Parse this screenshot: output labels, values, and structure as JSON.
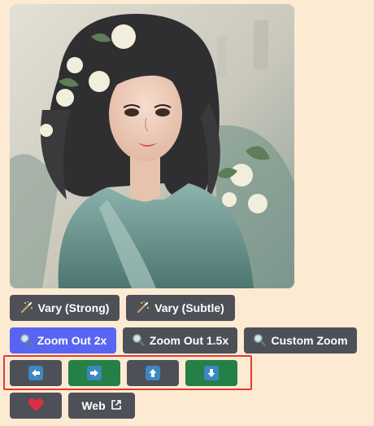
{
  "image": {
    "subject": "portrait-artwork"
  },
  "buttons": {
    "vary_strong": "Vary (Strong)",
    "vary_subtle": "Vary (Subtle)",
    "zoom_out_2x": "Zoom Out 2x",
    "zoom_out_1_5x": "Zoom Out 1.5x",
    "custom_zoom": "Custom Zoom",
    "web": "Web"
  },
  "icons": {
    "vary": "magic-wand-icon",
    "zoom": "magnifier-icon",
    "pan_left": "arrow-left-icon",
    "pan_right": "arrow-right-icon",
    "pan_up": "arrow-up-icon",
    "pan_down": "arrow-down-icon",
    "favorite": "heart-icon",
    "external": "external-link-icon"
  },
  "colors": {
    "background": "#fcebd2",
    "button_grey": "#4e5058",
    "button_blurple": "#5865f2",
    "button_green": "#248046",
    "highlight": "#e33a36",
    "heart": "#dd2e44",
    "arrow_tile": "#3b88c3"
  }
}
